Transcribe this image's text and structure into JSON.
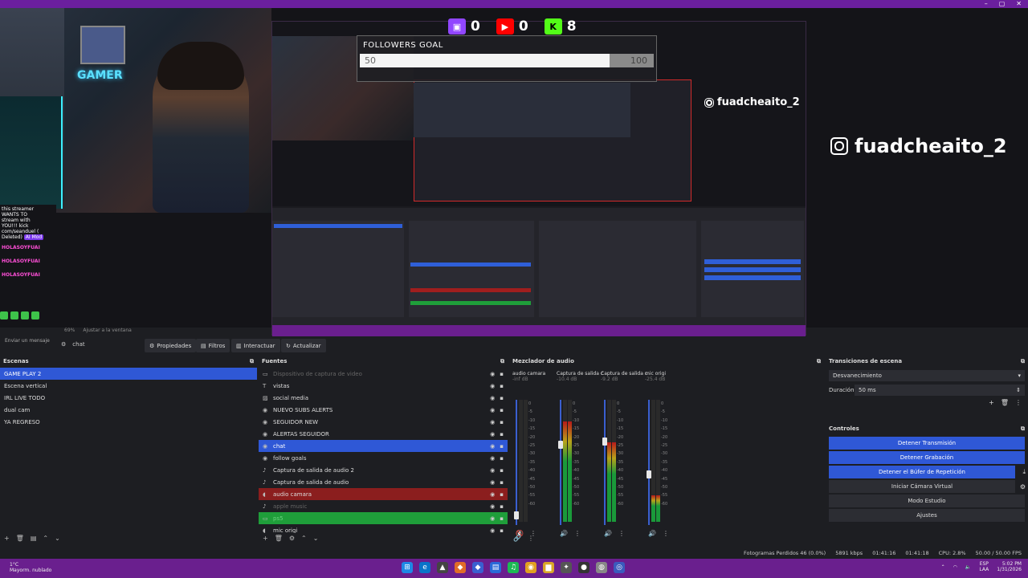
{
  "window": {
    "controls": [
      "–",
      "▢",
      "✕"
    ]
  },
  "overlay": {
    "counters": [
      {
        "platform": "twitch",
        "icon": "twitch-icon",
        "color": "#9146ff",
        "count": "0"
      },
      {
        "platform": "youtube",
        "icon": "youtube-icon",
        "color": "#ff0000",
        "count": "0"
      },
      {
        "platform": "kick",
        "icon": "kick-icon",
        "color": "#53fc18",
        "count": "8"
      }
    ],
    "followers_goal": {
      "title": "FOLLOWERS GOAL",
      "current": "50",
      "max": "100",
      "progress": 0.5
    },
    "instagram_handle_small": "fuadcheaito_2",
    "instagram_handle_big": "fuadcheaito_2",
    "webcam_neon": "GAMER",
    "chat": {
      "lines": [
        "this streamer",
        "WANTS TO",
        "stream with",
        "YOU!!! kick",
        "com/seanduel (",
        "Deleted)"
      ],
      "mod_badge": "AI Mod",
      "users": [
        "HOLASOYFUAI",
        "HOLASOYFUAI",
        "HOLASOYFUAI"
      ],
      "send_hint": "Enviar un mensaje"
    }
  },
  "preview_status": {
    "zoom": "69%",
    "fit": "Ajustar a la ventana"
  },
  "source_toolbar": {
    "source_name": "chat",
    "properties": "Propiedades",
    "filters": "Filtros",
    "interact": "Interactuar",
    "refresh": "Actualizar"
  },
  "scenes": {
    "title": "Escenas",
    "items": [
      "GAME PLAY 2",
      "Escena vertical",
      "IRL LIVE TODO",
      "dual cam",
      "YA REGRESO"
    ],
    "selected": 0
  },
  "sources": {
    "title": "Fuentes",
    "items": [
      {
        "name": "Dispositivo de captura de video",
        "style": "dim",
        "icon": "camera-icon"
      },
      {
        "name": "vistas",
        "style": "",
        "icon": "text-icon"
      },
      {
        "name": "social media",
        "style": "",
        "icon": "image-icon"
      },
      {
        "name": "NUEVO SUBS ALERTS",
        "style": "",
        "icon": "browser-icon"
      },
      {
        "name": "SEGUIDOR NEW",
        "style": "",
        "icon": "browser-icon"
      },
      {
        "name": "ALERTAS SEGUIDOR",
        "style": "",
        "icon": "browser-icon"
      },
      {
        "name": "chat",
        "style": "sel",
        "icon": "browser-icon"
      },
      {
        "name": "follow goals",
        "style": "",
        "icon": "browser-icon"
      },
      {
        "name": "Captura de salida de audio 2",
        "style": "",
        "icon": "speaker-icon"
      },
      {
        "name": "Captura de salida de audio",
        "style": "",
        "icon": "speaker-icon"
      },
      {
        "name": "audio camara",
        "style": "red",
        "icon": "mic-icon"
      },
      {
        "name": "apple music",
        "style": "dim",
        "icon": "speaker-icon"
      },
      {
        "name": "ps5",
        "style": "grn",
        "icon": "camera-icon"
      },
      {
        "name": "mic origi",
        "style": "",
        "icon": "mic-icon"
      }
    ]
  },
  "mixer": {
    "title": "Mezclador de audio",
    "channels": [
      {
        "name": "audio camara",
        "db": "-inf dB",
        "level": 0.0,
        "fader": 0.95,
        "muted": true
      },
      {
        "name": "Captura de salida c",
        "db": "-10.4 dB",
        "level": 0.82,
        "fader": 0.35
      },
      {
        "name": "Captura de salida c",
        "db": "-9.2 dB",
        "level": 0.65,
        "fader": 0.32
      },
      {
        "name": "mic origi",
        "db": "-25.4 dB",
        "level": 0.22,
        "fader": 0.6
      }
    ],
    "scale": [
      "0",
      "-5",
      "-10",
      "-15",
      "-20",
      "-25",
      "-30",
      "-35",
      "-40",
      "-45",
      "-50",
      "-55",
      "-60"
    ]
  },
  "transitions": {
    "title": "Transiciones de escena",
    "type": "Desvanecimiento",
    "duration_label": "Duración",
    "duration_value": "50 ms"
  },
  "controls": {
    "title": "Controles",
    "buttons": [
      {
        "label": "Detener Transmisión",
        "active": true
      },
      {
        "label": "Detener Grabación",
        "active": true
      },
      {
        "label": "Detener el Búfer de Repetición",
        "active": true
      },
      {
        "label": "Iniciar Cámara Virtual",
        "active": false
      },
      {
        "label": "Modo Estudio",
        "active": false
      },
      {
        "label": "Ajustes",
        "active": false
      }
    ]
  },
  "statusbar": {
    "dropped": "Fotogramas Perdidos 46 (0.0%)",
    "bitrate": "5891 kbps",
    "stream_time": "01:41:16",
    "rec_time": "01:41:18",
    "cpu": "CPU: 2.8%",
    "fps": "50.00 / 50.00 FPS"
  },
  "taskbar": {
    "weather_temp": "1°C",
    "weather_desc": "Mayorm. nublado",
    "lang": "ESP",
    "lang2": "LAA",
    "time": "5:02 PM",
    "date": "1/31/2026"
  }
}
